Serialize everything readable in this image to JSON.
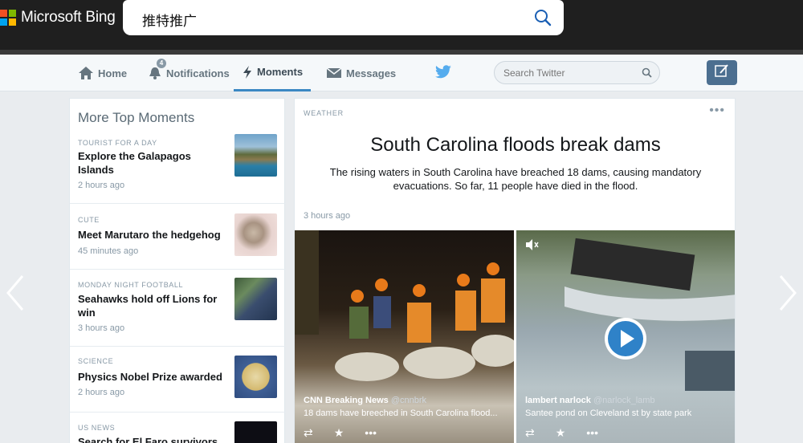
{
  "bing": {
    "brand": "Microsoft Bing",
    "query": "推特推广",
    "colors": {
      "red": "#f25022",
      "green": "#7fba00",
      "blue": "#00a4ef",
      "yellow": "#ffb900"
    }
  },
  "twitter": {
    "nav": {
      "home": "Home",
      "notifications": "Notifications",
      "notifications_badge": "4",
      "moments": "Moments",
      "messages": "Messages"
    },
    "search_placeholder": "Search Twitter",
    "active_tab": "Moments",
    "accent": "#3b88c3"
  },
  "more_moments": {
    "title": "More Top Moments",
    "items": [
      {
        "category": "TOURIST FOR A DAY",
        "headline": "Explore the Galapagos Islands",
        "time": "2 hours ago"
      },
      {
        "category": "CUTE",
        "headline": "Meet Marutaro the hedgehog",
        "time": "45 minutes ago"
      },
      {
        "category": "MONDAY NIGHT FOOTBALL",
        "headline": "Seahawks hold off Lions for win",
        "time": "3 hours ago"
      },
      {
        "category": "SCIENCE",
        "headline": "Physics Nobel Prize awarded",
        "time": "2 hours ago"
      },
      {
        "category": "US NEWS",
        "headline": "Search for El Faro survivors",
        "time": ""
      }
    ]
  },
  "feature": {
    "category": "WEATHER",
    "title": "South Carolina floods break dams",
    "description": "The rising waters in South Carolina have breached 18 dams, causing mandatory evacuations. So far, 11 people have died in the flood.",
    "time": "3 hours ago",
    "media": [
      {
        "author": "CNN Breaking News",
        "handle": "@cnnbrk",
        "text": "18 dams have breeched in South Carolina flood..."
      },
      {
        "author": "lambert narlock",
        "handle": "@narlock_lamb",
        "text": "Santee pond on Cleveland st by state park"
      }
    ]
  }
}
